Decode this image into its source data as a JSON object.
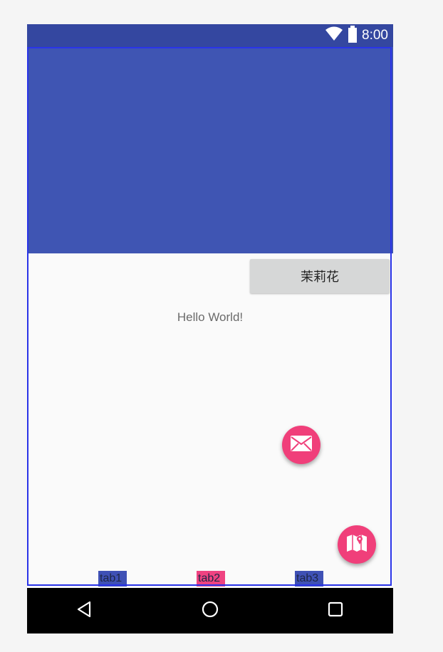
{
  "status_bar": {
    "time": "8:00",
    "icons": [
      "wifi-icon",
      "battery-icon"
    ],
    "color": "#3447a0"
  },
  "header": {
    "color": "#3f55b3"
  },
  "main": {
    "action_button_label": "茉莉花",
    "hello_text": "Hello World!"
  },
  "fabs": [
    {
      "name": "mail-fab",
      "icon": "mail-icon",
      "color": "#f03f7a"
    },
    {
      "name": "map-fab",
      "icon": "map-icon",
      "color": "#f03f7a"
    }
  ],
  "tabs": [
    {
      "label": "tab1",
      "color": "#3f51b5"
    },
    {
      "label": "tab2",
      "color": "#ef4381"
    },
    {
      "label": "tab3",
      "color": "#3f51b5"
    }
  ],
  "nav_bar": {
    "icons": [
      "back-icon",
      "home-icon",
      "recent-apps-icon"
    ]
  }
}
